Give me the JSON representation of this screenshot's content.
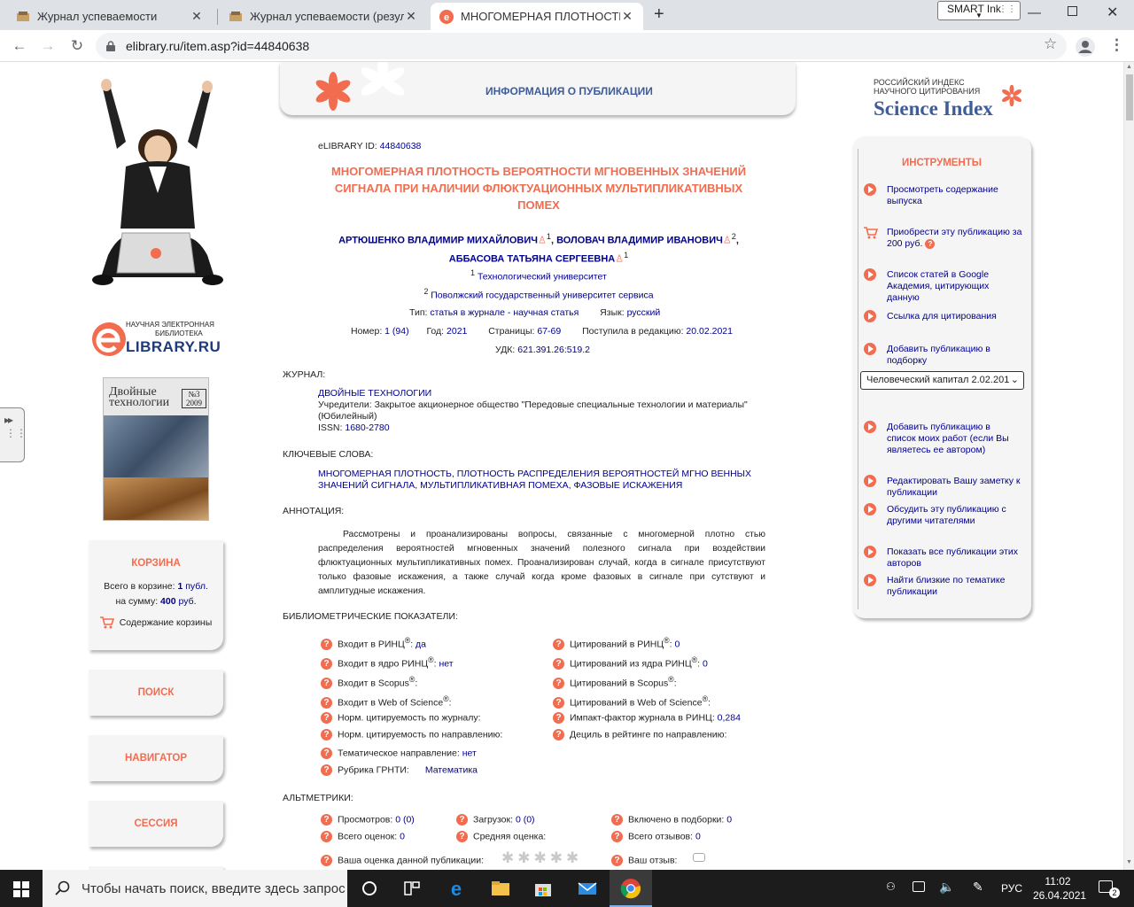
{
  "tabs": [
    {
      "title": "Журнал успеваемости",
      "active": false
    },
    {
      "title": "Журнал успеваемости (результа",
      "active": false
    },
    {
      "title": "МНОГОМЕРНАЯ ПЛОТНОСТЬ В",
      "active": true
    }
  ],
  "smart_ink": "SMART Ink",
  "url": "elibrary.ru/item.asp?id=44840638",
  "header_title": "ИНФОРМАЦИЯ О ПУБЛИКАЦИИ",
  "logo": {
    "line1": "НАУЧНАЯ ЭЛЕКТРОННАЯ",
    "line2": "БИБЛИОТЕКА",
    "name": "LIBRARY.RU"
  },
  "science_index": {
    "line1": "РОССИЙСКИЙ ИНДЕКС",
    "line2": "НАУЧНОГО ЦИТИРОВАНИЯ",
    "name": "Science Index"
  },
  "cover": {
    "title1": "Двойные",
    "title2": "технологии",
    "num": "№3",
    "year": "2009"
  },
  "basket": {
    "title": "КОРЗИНА",
    "total_label": "Всего в корзине:",
    "total_value": "1",
    "total_unit": "публ.",
    "sum_label": "на сумму:",
    "sum_value": "400",
    "sum_unit": "руб.",
    "contents_link": "Содержание корзины"
  },
  "left_buttons": [
    "ПОИСК",
    "НАВИГАТОР",
    "СЕССИЯ"
  ],
  "elibrary_id_label": "eLIBRARY ID:",
  "elibrary_id": "44840638",
  "title_lines": [
    "МНОГОМЕРНАЯ ПЛОТНОСТЬ ВЕРОЯТНОСТИ МГНОВЕННЫХ ЗНАЧЕНИЙ",
    "СИГНАЛА ПРИ НАЛИЧИИ ФЛЮКТУАЦИОННЫХ МУЛЬТИПЛИКАТИВНЫХ",
    "ПОМЕХ"
  ],
  "authors": [
    {
      "name": "АРТЮШЕНКО ВЛАДИМИР МИХАЙЛОВИЧ",
      "sup": "1"
    },
    {
      "name": "ВОЛОВАЧ ВЛАДИМИР ИВАНОВИЧ",
      "sup": "2"
    },
    {
      "name": "АББАСОВА ТАТЬЯНА СЕРГЕЕВНА",
      "sup": "1"
    }
  ],
  "affiliations": [
    {
      "sup": "1",
      "name": "Технологический университет"
    },
    {
      "sup": "2",
      "name": "Поволжский государственный университет сервиса"
    }
  ],
  "meta": {
    "type_label": "Тип:",
    "type_value": "статья в журнале - научная статья",
    "lang_label": "Язык:",
    "lang_value": "русский",
    "number_label": "Номер:",
    "number_value": "1 (94)",
    "year_label": "Год:",
    "year_value": "2021",
    "pages_label": "Страницы:",
    "pages_value": "67-69",
    "received_label": "Поступила в редакцию:",
    "received_value": "20.02.2021",
    "udc_label": "УДК:",
    "udc_value": "621.391.26:519.2"
  },
  "journal": {
    "heading": "ЖУРНАЛ:",
    "name": "ДВОЙНЫЕ ТЕХНОЛОГИИ",
    "founders_line1": "Учредители: Закрытое акционерное общество \"Передовые специальные технологии и материалы\"",
    "founders_line2": "(Юбилейный)",
    "issn_label": "ISSN:",
    "issn": "1680-2780"
  },
  "keywords": {
    "heading": "КЛЮЧЕВЫЕ СЛОВА:",
    "line1": "МНОГОМЕРНАЯ ПЛОТНОСТЬ, ПЛОТНОСТЬ РАСПРЕДЕЛЕНИЯ ВЕРОЯТНОСТЕЙ МГНО ВЕННЫХ",
    "line2": "ЗНАЧЕНИЙ СИГНАЛА, МУЛЬТИПЛИКАТИВНАЯ ПОМЕХА, ФАЗОВЫЕ ИСКАЖЕНИЯ"
  },
  "annotation": {
    "heading": "АННОТАЦИЯ:",
    "text": "Рассмотрены и проанализированы вопросы, связанные с многомерной плотно стью распределения вероятностей мгновенных значений полезного сигнала при воздействии флюктуационных мультипликативных помех. Проанализирован случай, когда в сигнале присутствуют только фазовые искажения, а также случай когда кроме фазовых в сигнале при сутствуют и амплитудные искажения."
  },
  "biblio": {
    "heading": "БИБЛИОМЕТРИЧЕСКИЕ ПОКАЗАТЕЛИ:",
    "left": [
      {
        "label": "Входит в РИНЦ",
        "sup": "®",
        "value": "да"
      },
      {
        "label": "Входит в ядро РИНЦ",
        "sup": "®",
        "value": "нет"
      },
      {
        "label": "Входит в Scopus",
        "sup": "®",
        "value": ""
      },
      {
        "label": "Входит в Web of Science",
        "sup": "®",
        "value": ""
      },
      {
        "label": "Норм. цитируемость по журналу:",
        "sup": "",
        "value": ""
      },
      {
        "label": "Норм. цитируемость по направлению:",
        "sup": "",
        "value": ""
      },
      {
        "label": "Тематическое направление:",
        "sup": "",
        "value": "нет"
      },
      {
        "label": "Рубрика ГРНТИ:",
        "sup": "",
        "value": "Математика"
      }
    ],
    "right": [
      {
        "label": "Цитирований в РИНЦ",
        "sup": "®",
        "value": "0"
      },
      {
        "label": "Цитирований из ядра РИНЦ",
        "sup": "®",
        "value": "0"
      },
      {
        "label": "Цитирований в Scopus",
        "sup": "®",
        "value": ""
      },
      {
        "label": "Цитирований в Web of Science",
        "sup": "®",
        "value": ""
      },
      {
        "label": "Импакт-фактор журнала в РИНЦ:",
        "sup": "",
        "value": "0,284"
      },
      {
        "label": "Дециль в рейтинге по направлению:",
        "sup": "",
        "value": ""
      }
    ]
  },
  "altmetrics": {
    "heading": "АЛЬТМЕТРИКИ:",
    "views_label": "Просмотров:",
    "views_value": "0 (0)",
    "downloads_label": "Загрузок:",
    "downloads_value": "0 (0)",
    "collections_label": "Включено в подборки:",
    "collections_value": "0",
    "ratings_label": "Всего оценок:",
    "ratings_value": "0",
    "avg_label": "Средняя оценка:",
    "reviews_label": "Всего отзывов:",
    "reviews_value": "0",
    "your_rating_label": "Ваша оценка данной публикации:",
    "your_review_label": "Ваш отзыв:"
  },
  "tools": {
    "title": "ИНСТРУМЕНТЫ",
    "items": [
      {
        "l1": "Просмотреть содержание",
        "l2": "выпуска",
        "l3": ""
      },
      {
        "l1": "Приобрести эту публикацию за",
        "l2": "200 руб.",
        "l3": ""
      },
      {
        "l1": "Список статей в Google",
        "l2": "Академия, цитирующих",
        "l3": "данную"
      },
      {
        "l1": "Ссылка для цитирования",
        "l2": "",
        "l3": ""
      },
      {
        "l1": "Добавить публикацию в",
        "l2": "подборку",
        "l3": ""
      },
      {
        "l1": "Добавить публикацию в",
        "l2": "список моих работ (если Вы",
        "l3": "являетесь ее автором)"
      },
      {
        "l1": "Редактировать Вашу заметку к",
        "l2": "публикации",
        "l3": ""
      },
      {
        "l1": "Обсудить эту публикацию с",
        "l2": "другими читателями",
        "l3": ""
      },
      {
        "l1": "Показать все публикации этих",
        "l2": "авторов",
        "l3": ""
      },
      {
        "l1": "Найти близкие по тематике",
        "l2": "публикации",
        "l3": ""
      }
    ],
    "select_value": "Человеческий капитал 2.02.201"
  },
  "taskbar": {
    "search_placeholder": "Чтобы начать поиск, введите здесь запрос",
    "lang": "РУС",
    "time": "11:02",
    "date": "26.04.2021",
    "notif_count": "2"
  }
}
